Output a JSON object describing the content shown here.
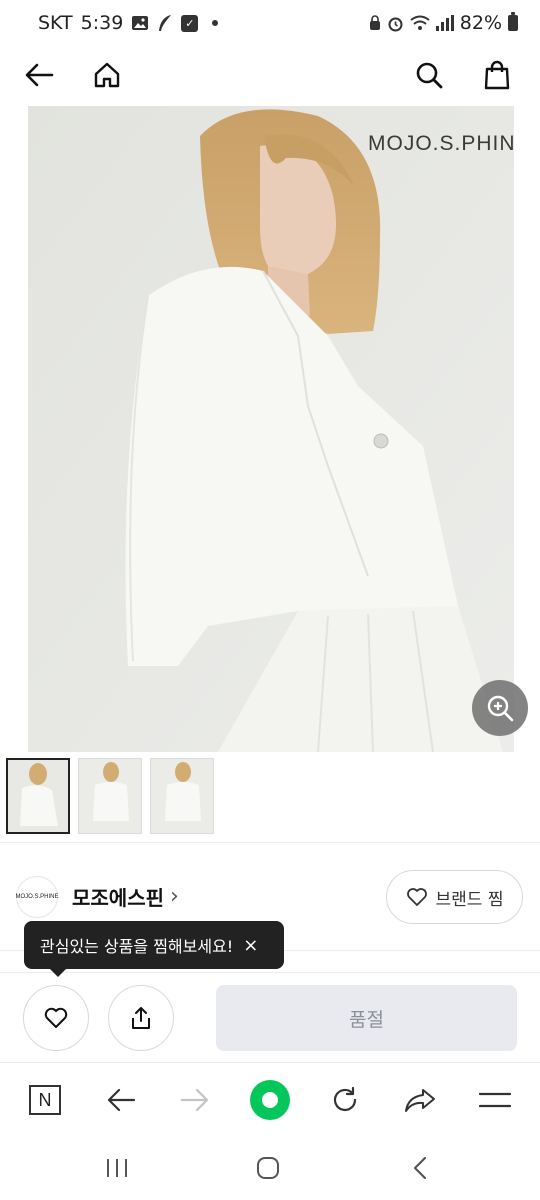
{
  "status_bar": {
    "carrier": "SKT",
    "time": "5:39",
    "battery": "82%"
  },
  "header": {
    "back_icon": "arrow-left-icon",
    "home_icon": "home-icon",
    "search_icon": "search-icon",
    "cart_icon": "shopping-bag-icon"
  },
  "product": {
    "image_brand_text": "MOJO.S.PHINE",
    "zoom_icon": "zoom-in-icon",
    "thumbnails_count": 3,
    "selected_thumbnail": 1
  },
  "brand": {
    "logo_text": "MOJO.S.PHINE",
    "name": "모조에스핀",
    "chevron": "›",
    "favorite_label": "브랜드 찜"
  },
  "tooltip": {
    "text": "관심있는 상품을 찜해보세요!",
    "close": "×"
  },
  "actions": {
    "like_icon": "heart-icon",
    "share_icon": "share-icon",
    "soldout_label": "품절"
  },
  "browser_toolbar": {
    "icons": [
      "naver-n-icon",
      "back-arrow-icon",
      "forward-arrow-icon",
      "green-dot-icon",
      "refresh-icon",
      "share-arrow-icon",
      "menu-icon"
    ],
    "n_label": "N"
  },
  "colors": {
    "tooltip_bg": "#222222",
    "soldout_bg": "#e8eaf0",
    "green_accent": "#03c75a"
  }
}
